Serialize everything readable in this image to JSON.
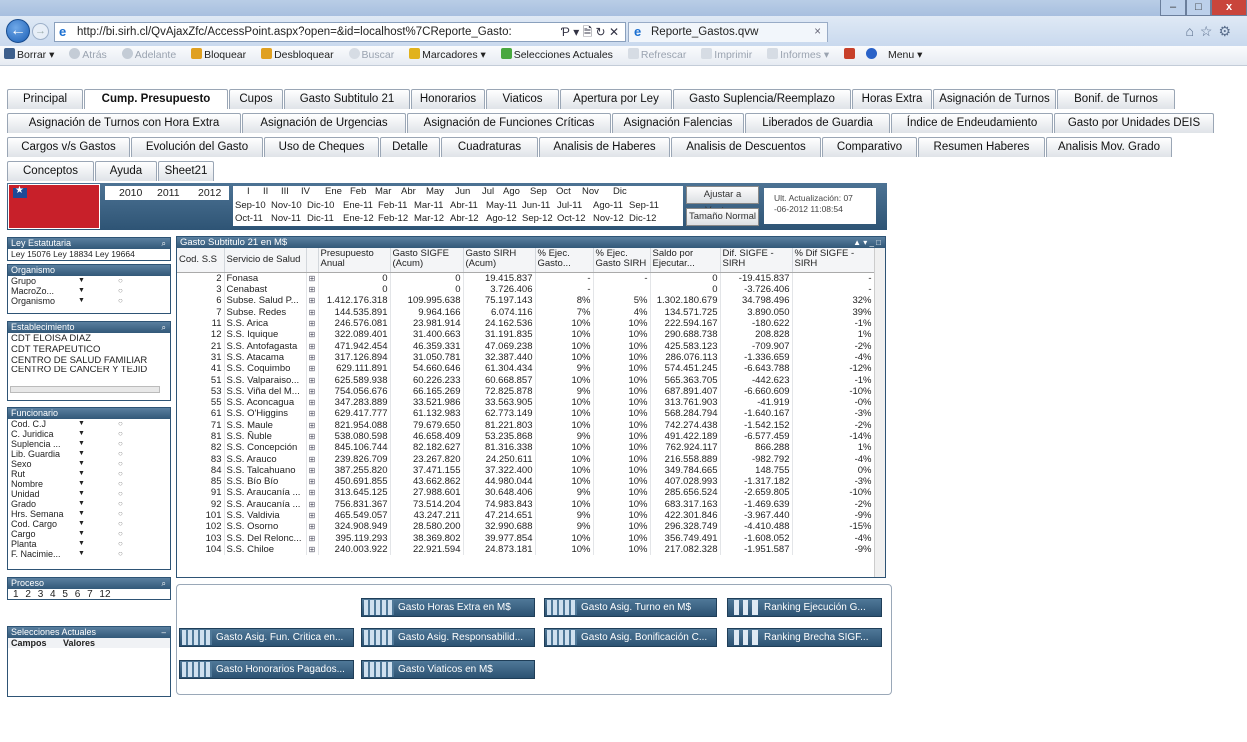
{
  "window": {
    "minimize": "–",
    "maximize": "□",
    "close": "x"
  },
  "browser": {
    "url": "http://bi.sirh.cl/QvAjaxZfc/AccessPoint.aspx?open=&id=localhost%7CReporte_Gasto:",
    "url_controls": "Ƥ ▾ 🗎 ↻ ✕",
    "tab_title": "Reporte_Gastos.qvw",
    "tab_close": "×",
    "right_icons": "⌂☆⚙"
  },
  "qv_toolbar": {
    "items": [
      "Borrar ▾",
      "Atrás",
      "Adelante",
      "Bloquear",
      "Desbloquear",
      "Buscar",
      "Marcadores ▾",
      "Selecciones Actuales",
      "Refrescar",
      "Imprimir",
      "Informes ▾",
      "Menu ▾"
    ]
  },
  "tabs_row1": [
    "Principal",
    "Cump. Presupuesto",
    "Cupos",
    "Gasto Subtitulo 21",
    "Honorarios",
    "Viaticos",
    "Apertura por Ley",
    "Gasto Suplencia/Reemplazo",
    "Horas Extra",
    "Asignación de Turnos",
    "Bonif. de Turnos"
  ],
  "tabs_row2": [
    "Asignación de Turnos con Hora Extra",
    "Asignación de Urgencias",
    "Asignación de Funciones Críticas",
    "Asignación Falencias",
    "Liberados de Guardia",
    "Índice de Endeudamiento",
    "Gasto por Unidades DEIS"
  ],
  "tabs_row3": [
    "Cargos v/s Gastos",
    "Evolución del Gasto",
    "Uso de Cheques",
    "Detalle",
    "Cuadraturas",
    "Analisis de Haberes",
    "Analisis de Descuentos",
    "Comparativo",
    "Resumen Haberes",
    "Analisis Mov. Grado"
  ],
  "tabs_row4": [
    "Conceptos",
    "Ayuda",
    "Sheet21"
  ],
  "years": [
    "2010",
    "2011",
    "2012"
  ],
  "months": [
    "I",
    "II",
    "III",
    "IV",
    "Ene",
    "Feb",
    "Mar",
    "Abr",
    "May",
    "Jun",
    "Jul",
    "Ago",
    "Sep",
    "Oct",
    "Nov",
    "Dic"
  ],
  "periods_row1": [
    "Sep-10",
    "Nov-10",
    "Dic-10",
    "Ene-11",
    "Feb-11",
    "Mar-11",
    "Abr-11",
    "May-11",
    "Jun-11",
    "Jul-11",
    "Ago-11",
    "Sep-11"
  ],
  "periods_row2": [
    "Oct-11",
    "Nov-11",
    "Dic-11",
    "Ene-12",
    "Feb-12",
    "Mar-12",
    "Abr-12",
    "Ago-12",
    "Sep-12",
    "Oct-12",
    "Nov-12",
    "Dic-12"
  ],
  "buttons": {
    "fit": "Ajustar a Ventana",
    "normal": "Tamaño Normal"
  },
  "last_update": {
    "line1": "Ult. Actualización: 07",
    "line2": "-06-2012 11:08:54"
  },
  "ley": {
    "title": "Ley Estatutaria",
    "value": "Ley 15076 Ley 18834 Ley 19664"
  },
  "organismo": {
    "title": "Organismo",
    "rows": [
      "Grupo",
      "MacroZo...",
      "Organismo"
    ]
  },
  "establecimiento": {
    "title": "Establecimiento",
    "rows": [
      "CDT ELOISA DIAZ",
      "CDT TERAPEUTICO",
      "CENTRO DE SALUD FAMILIAR",
      "CENTRO DE CANCER Y TEJID"
    ]
  },
  "funcionario": {
    "title": "Funcionario",
    "rows": [
      "Cod. C.J",
      "C. Juridica",
      "Suplencia ...",
      "Lib. Guardia",
      "Sexo",
      "Rut",
      "Nombre",
      "Unidad",
      "Grado",
      "Hrs. Semana",
      "Cod. Cargo",
      "Cargo",
      "Planta",
      "F. Nacimie..."
    ]
  },
  "proceso": {
    "title": "Proceso",
    "values": [
      "1",
      "2",
      "3",
      "4",
      "5",
      "6",
      "7",
      "12"
    ]
  },
  "selecciones": {
    "title": "Selecciones Actuales",
    "col1": "Campos",
    "col2": "Valores"
  },
  "gasto_table": {
    "title": "Gasto Subtitulo 21 en M$",
    "header_icons": "▲ ▾ _ □",
    "headers": [
      "Cod. S.S",
      "Servicio de Salud",
      "",
      "Presupuesto Anual",
      "Gasto SIGFE (Acum)",
      "Gasto SIRH (Acum)",
      "% Ejec. Gasto...",
      "% Ejec. Gasto SIRH",
      "Saldo por Ejecutar...",
      "Dif. SIGFE - SIRH",
      "% Dif SIGFE - SIRH"
    ],
    "rows": [
      [
        "2",
        "Fonasa",
        "0",
        "0",
        "19.415.837",
        "-",
        "-",
        "0",
        "-19.415.837",
        "-"
      ],
      [
        "3",
        "Cenabast",
        "0",
        "0",
        "3.726.406",
        "-",
        "",
        "0",
        "-3.726.406",
        "-"
      ],
      [
        "6",
        "Subse. Salud P...",
        "1.412.176.318",
        "109.995.638",
        "75.197.143",
        "8%",
        "5%",
        "1.302.180.679",
        "34.798.496",
        "32%"
      ],
      [
        "7",
        "Subse. Redes",
        "144.535.891",
        "9.964.166",
        "6.074.116",
        "7%",
        "4%",
        "134.571.725",
        "3.890.050",
        "39%"
      ],
      [
        "11",
        "S.S. Arica",
        "246.576.081",
        "23.981.914",
        "24.162.536",
        "10%",
        "10%",
        "222.594.167",
        "-180.622",
        "-1%"
      ],
      [
        "12",
        "S.S. Iquique",
        "322.089.401",
        "31.400.663",
        "31.191.835",
        "10%",
        "10%",
        "290.688.738",
        "208.828",
        "1%"
      ],
      [
        "21",
        "S.S. Antofagasta",
        "471.942.454",
        "46.359.331",
        "47.069.238",
        "10%",
        "10%",
        "425.583.123",
        "-709.907",
        "-2%"
      ],
      [
        "31",
        "S.S. Atacama",
        "317.126.894",
        "31.050.781",
        "32.387.440",
        "10%",
        "10%",
        "286.076.113",
        "-1.336.659",
        "-4%"
      ],
      [
        "41",
        "S.S. Coquimbo",
        "629.111.891",
        "54.660.646",
        "61.304.434",
        "9%",
        "10%",
        "574.451.245",
        "-6.643.788",
        "-12%"
      ],
      [
        "51",
        "S.S. Valparaiso...",
        "625.589.938",
        "60.226.233",
        "60.668.857",
        "10%",
        "10%",
        "565.363.705",
        "-442.623",
        "-1%"
      ],
      [
        "53",
        "S.S. Viña del M...",
        "754.056.676",
        "66.165.269",
        "72.825.878",
        "9%",
        "10%",
        "687.891.407",
        "-6.660.609",
        "-10%"
      ],
      [
        "55",
        "S.S. Aconcagua",
        "347.283.889",
        "33.521.986",
        "33.563.905",
        "10%",
        "10%",
        "313.761.903",
        "-41.919",
        "-0%"
      ],
      [
        "61",
        "S.S. O'Higgins",
        "629.417.777",
        "61.132.983",
        "62.773.149",
        "10%",
        "10%",
        "568.284.794",
        "-1.640.167",
        "-3%"
      ],
      [
        "71",
        "S.S. Maule",
        "821.954.088",
        "79.679.650",
        "81.221.803",
        "10%",
        "10%",
        "742.274.438",
        "-1.542.152",
        "-2%"
      ],
      [
        "81",
        "S.S. Ñuble",
        "538.080.598",
        "46.658.409",
        "53.235.868",
        "9%",
        "10%",
        "491.422.189",
        "-6.577.459",
        "-14%"
      ],
      [
        "82",
        "S.S. Concepción",
        "845.106.744",
        "82.182.627",
        "81.316.338",
        "10%",
        "10%",
        "762.924.117",
        "866.288",
        "1%"
      ],
      [
        "83",
        "S.S. Arauco",
        "239.826.709",
        "23.267.820",
        "24.250.611",
        "10%",
        "10%",
        "216.558.889",
        "-982.792",
        "-4%"
      ],
      [
        "84",
        "S.S. Talcahuano",
        "387.255.820",
        "37.471.155",
        "37.322.400",
        "10%",
        "10%",
        "349.784.665",
        "148.755",
        "0%"
      ],
      [
        "85",
        "S.S. Bío Bío",
        "450.691.855",
        "43.662.862",
        "44.980.044",
        "10%",
        "10%",
        "407.028.993",
        "-1.317.182",
        "-3%"
      ],
      [
        "91",
        "S.S. Araucanía ...",
        "313.645.125",
        "27.988.601",
        "30.648.406",
        "9%",
        "10%",
        "285.656.524",
        "-2.659.805",
        "-10%"
      ],
      [
        "92",
        "S.S. Araucanía ...",
        "756.831.367",
        "73.514.204",
        "74.983.843",
        "10%",
        "10%",
        "683.317.163",
        "-1.469.639",
        "-2%"
      ],
      [
        "101",
        "S.S. Valdivia",
        "465.549.057",
        "43.247.211",
        "47.214.651",
        "9%",
        "10%",
        "422.301.846",
        "-3.967.440",
        "-9%"
      ],
      [
        "102",
        "S.S. Osorno",
        "324.908.949",
        "28.580.200",
        "32.990.688",
        "9%",
        "10%",
        "296.328.749",
        "-4.410.488",
        "-15%"
      ],
      [
        "103",
        "S.S. Del Relonc...",
        "395.119.293",
        "38.369.802",
        "39.977.854",
        "10%",
        "10%",
        "356.749.491",
        "-1.608.052",
        "-4%"
      ],
      [
        "104",
        "S.S. Chiloe",
        "240.003.922",
        "22.921.594",
        "24.873.181",
        "10%",
        "10%",
        "217.082.328",
        "-1.951.587",
        "-9%"
      ]
    ]
  },
  "chart_buttons": [
    "Gasto Horas Extra en M$",
    "Gasto Asig. Turno en M$",
    "Ranking Ejecución G...",
    "Gasto Asig. Fun. Critica en...",
    "Gasto Asig. Responsabilid...",
    "Gasto Asig. Bonificación C...",
    "Ranking Brecha SIGF...",
    "Gasto Honorarios Pagados...",
    "Gasto Viaticos en M$"
  ]
}
